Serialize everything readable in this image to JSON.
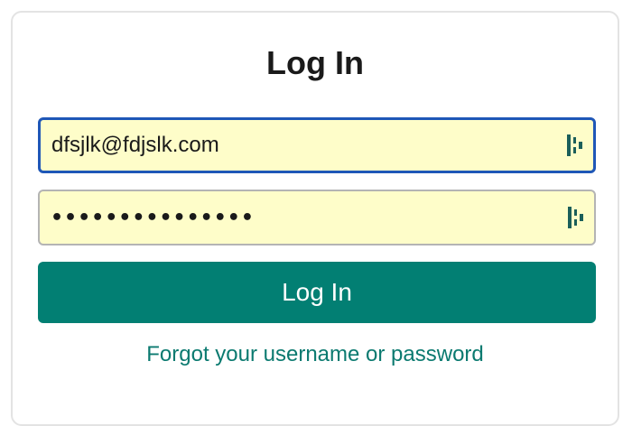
{
  "login": {
    "title": "Log In",
    "email_value": "dfsjlk@fdjslk.com",
    "password_mask": "•••••••••••••••",
    "submit_label": "Log In",
    "forgot_link": "Forgot your username or password"
  },
  "icons": {
    "email_field_icon": "password-manager-icon",
    "password_field_icon": "password-manager-icon"
  },
  "colors": {
    "brand_button": "#027f73",
    "link": "#0b7a70",
    "focus_border": "#1f57b7",
    "autofill_background": "#fefdc9"
  }
}
